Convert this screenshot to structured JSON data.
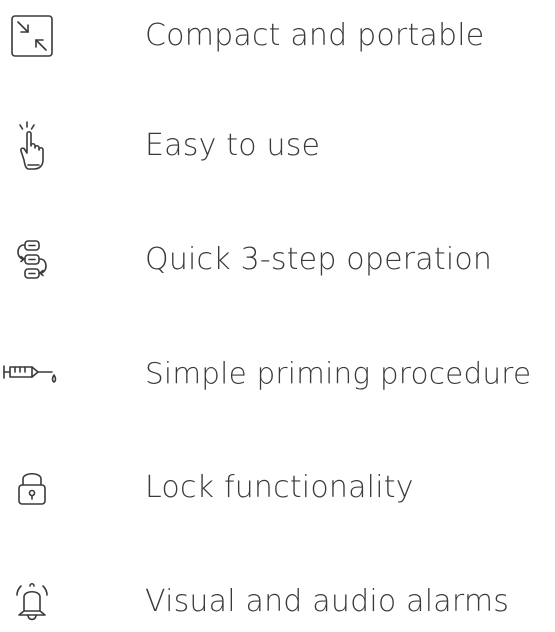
{
  "features": [
    {
      "label": "Compact and portable",
      "icon": "resize-arrows-icon"
    },
    {
      "label": "Easy to use",
      "icon": "tap-finger-icon"
    },
    {
      "label": "Quick 3-step operation",
      "icon": "step-sequence-icon"
    },
    {
      "label": "Simple priming procedure",
      "icon": "syringe-icon"
    },
    {
      "label": "Lock functionality",
      "icon": "lock-icon"
    },
    {
      "label": "Visual and audio alarms",
      "icon": "bell-icon"
    }
  ],
  "colors": {
    "text": "#3a3a3a",
    "icon": "#3a3a3a",
    "background": "#ffffff"
  }
}
